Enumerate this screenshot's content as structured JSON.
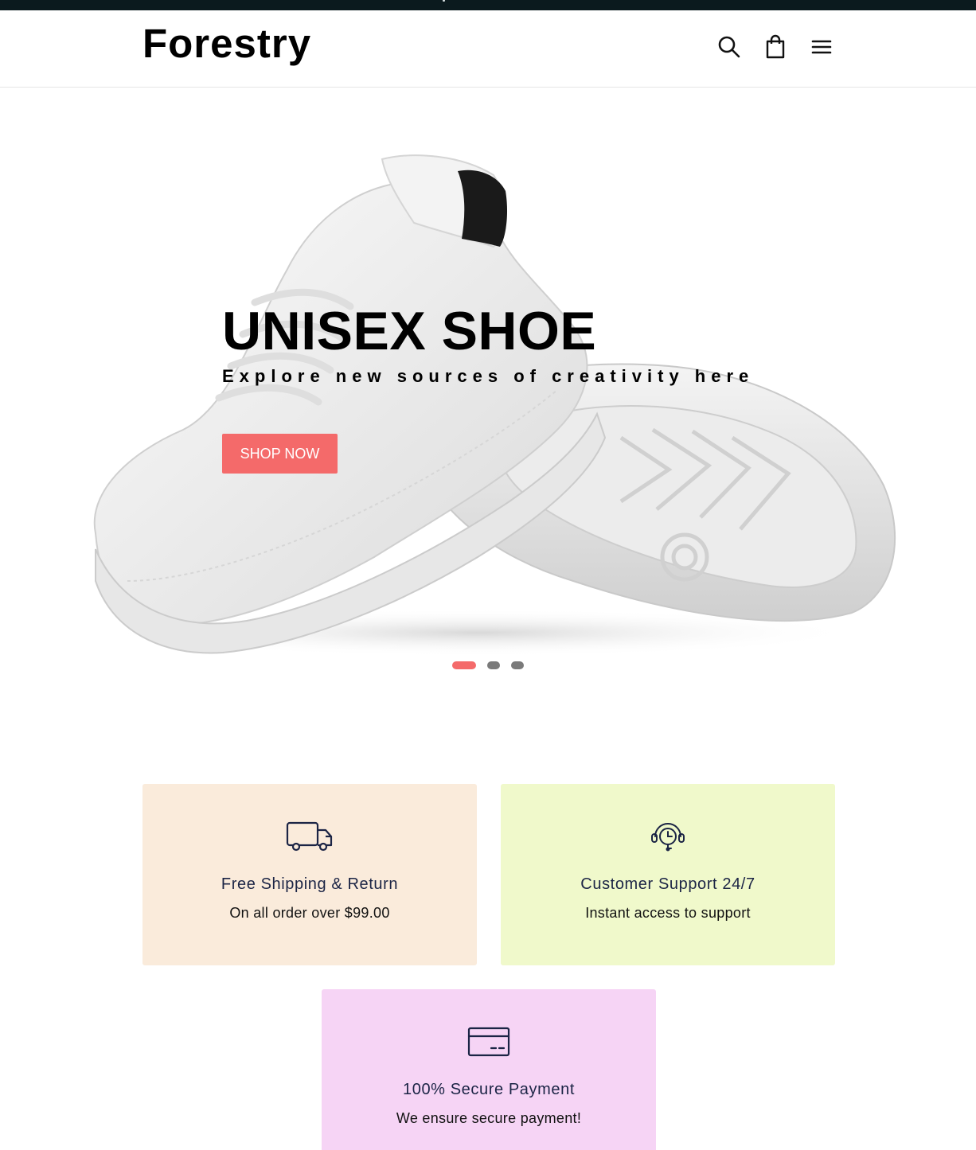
{
  "brand": {
    "name": "Forestry"
  },
  "header": {
    "icons": [
      "search-icon",
      "cart-icon",
      "menu-icon"
    ]
  },
  "hero": {
    "title": "UNISEX SHOE",
    "subtitle": "Explore new sources of creativity here",
    "cta_label": "SHOP NOW",
    "slides_count": 3,
    "active_slide": 1
  },
  "features": [
    {
      "icon": "truck-icon",
      "title": "Free Shipping & Return",
      "subtitle": "On all order over $99.00",
      "bg": "#faebdb"
    },
    {
      "icon": "support-headset-icon",
      "title": "Customer Support 24/7",
      "subtitle": "Instant access to support",
      "bg": "#f0f9cb"
    },
    {
      "icon": "credit-card-icon",
      "title": "100% Secure Payment",
      "subtitle": "We ensure secure payment!",
      "bg": "#f6d4f5"
    }
  ],
  "colors": {
    "accent": "#f46a6a",
    "announcement_bar": "#0b1a1e",
    "icon_stroke": "#1b2445"
  }
}
